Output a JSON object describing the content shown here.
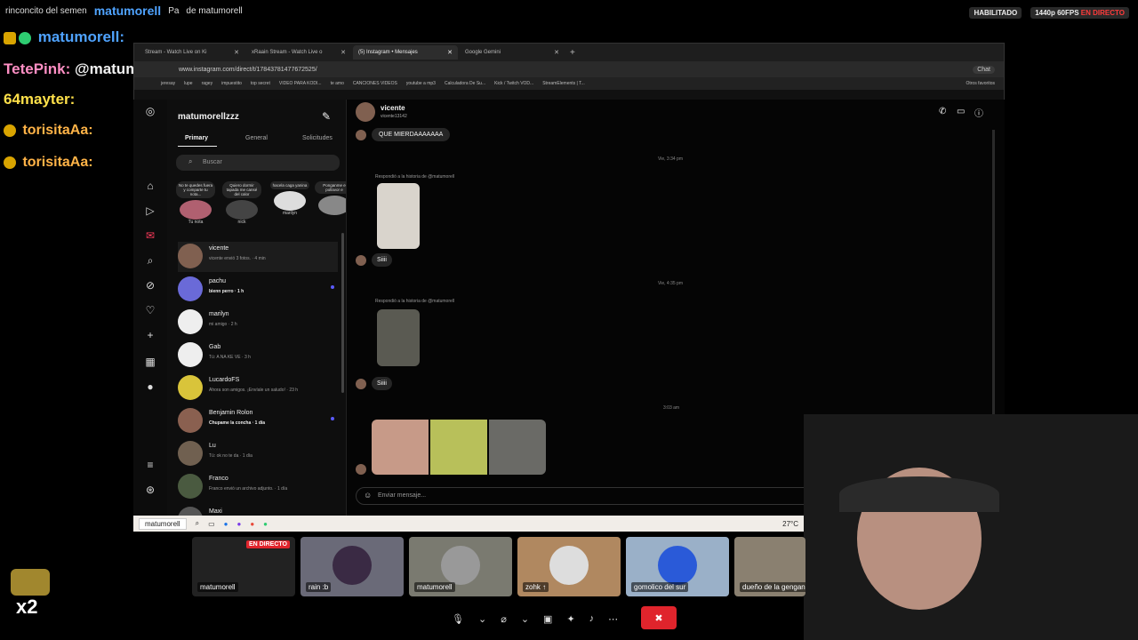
{
  "overlay": {
    "top_line_a": "rinconcito del semen",
    "top_line_user": "matumorell",
    "top_line_b": "Pa",
    "top_line_c": "de matumorell",
    "habilitado": "HABILITADO",
    "quality": "1440p 60FPS",
    "live": "EN DIRECTO"
  },
  "chat": [
    {
      "name": "matumorell:",
      "text": ""
    },
    {
      "name": "matumorell:",
      "text": ""
    },
    {
      "name": "TetePink:",
      "text": "@matumorell ig"
    },
    {
      "name": "64mayter:",
      "text": ""
    },
    {
      "name": "torisitaAa:",
      "text": ""
    },
    {
      "name": "torisitaAa:",
      "text": ""
    }
  ],
  "gift_count": "x2",
  "browser": {
    "tabs": [
      {
        "label": "Stream - Watch Live on Ki",
        "active": false
      },
      {
        "label": "xRaain Stream - Watch Live o",
        "active": false
      },
      {
        "label": "(5) Instagram • Mensajes",
        "active": true
      },
      {
        "label": "Google Gemini",
        "active": false
      }
    ],
    "url": "www.instagram.com/direct/t/17843781477672525/",
    "chat_btn": "Chat",
    "bookmarks": [
      "jeresay",
      "lupe",
      "ragey",
      "impuestito",
      "top secret",
      "VIDEO PARA KODI...",
      "te amo",
      "CANCIONES VIDEOS",
      "youtube a mp3",
      "Calculadora De Su...",
      "Kick / Twitch VOD...",
      "StreamElements | T..."
    ],
    "other_bookmarks": "Otros favoritos"
  },
  "ig": {
    "account": "matumorellzzz",
    "tabs": [
      "Primary",
      "General",
      "Solicitudes"
    ],
    "search_placeholder": "Buscar",
    "notes": [
      {
        "bubble": "No te quedes fuera y comparte tu nota...",
        "name": "Tu nota"
      },
      {
        "bubble": "Quiero dormir tapada me cansé del calor",
        "name": "nick"
      },
      {
        "bubble": "hacela caga yanina",
        "name": "marilyn"
      },
      {
        "bubble": "Ponganme e pollavor e",
        "name": ""
      }
    ],
    "threads": [
      {
        "name": "vicente",
        "sub": "vicente envió 3 fotos. · 4 min",
        "bold": false,
        "unread": false
      },
      {
        "name": "pachu",
        "sub": "bienn perro · 1 h",
        "bold": true,
        "unread": true
      },
      {
        "name": "marilyn",
        "sub": "mi amigo · 2 h",
        "bold": false,
        "unread": false
      },
      {
        "name": "Gab",
        "sub": "Tú: A NA KE VE · 3 h",
        "bold": false,
        "unread": false
      },
      {
        "name": "LucardoFS",
        "sub": "Ahora son amigos. ¡Envíale un saludo! · 23 h",
        "bold": false,
        "unread": false
      },
      {
        "name": "Benjamin Rolon",
        "sub": "Chupame la concha · 1 día",
        "bold": true,
        "unread": true
      },
      {
        "name": "Lu",
        "sub": "Tú: ok no te da · 1 día",
        "bold": false,
        "unread": false
      },
      {
        "name": "Franco",
        "sub": "Franco envió un archivo adjunto. · 1 día",
        "bold": false,
        "unread": false
      },
      {
        "name": "Maxi",
        "sub": "",
        "bold": false,
        "unread": false
      }
    ],
    "conversation": {
      "name": "vicente",
      "handle": "vicente13142",
      "first_msg": "QUE MIERDAAAAAAA",
      "time1": "Vie, 3:34 pm",
      "story_reply1": "Respondió a la historia de @matumorell",
      "reply1": "Siiii",
      "time2": "Vie, 4:35 pm",
      "story_reply2": "Respondió a la historia de @matumorell",
      "reply2": "Siiii",
      "time3": "3:03 am",
      "input_placeholder": "Enviar mensaje..."
    }
  },
  "taskbar": {
    "label": "matumorell",
    "weather": "27°C"
  },
  "participants": [
    {
      "name": "matumorell",
      "live": "EN DIRECTO",
      "color": "#2a2a2a"
    },
    {
      "name": "rain :b",
      "color": "#6a6a78"
    },
    {
      "name": "matumorell",
      "color": "#7a7a70"
    },
    {
      "name": "zohk ↑",
      "color": "#b08860"
    },
    {
      "name": "gomolico del sur",
      "color": "#9ab0c8"
    },
    {
      "name": "dueño de la gengan",
      "color": "#8a8070"
    }
  ],
  "colors": {
    "accent": "#4fa3ff",
    "live": "#e0242c",
    "unread": "#5b5bff"
  }
}
